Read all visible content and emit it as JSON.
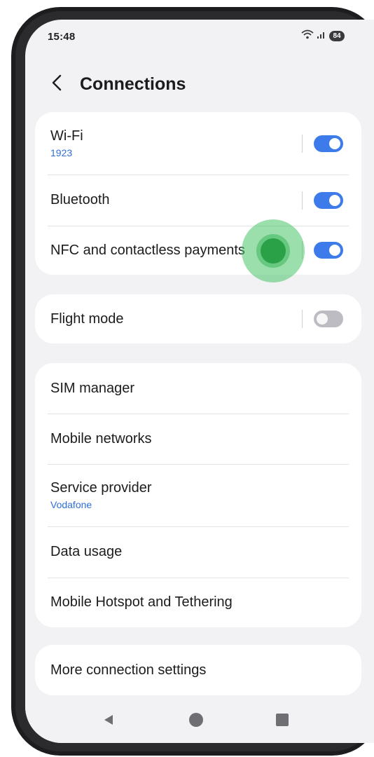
{
  "status_bar": {
    "time": "15:48",
    "battery": "84",
    "icons": [
      "wifi-icon",
      "signal-icon",
      "battery-icon"
    ]
  },
  "header": {
    "back_icon": "chevron-left-icon",
    "title": "Connections"
  },
  "groups": {
    "wireless": [
      {
        "label": "Wi-Fi",
        "sub": "1923",
        "toggle": true
      },
      {
        "label": "Bluetooth",
        "toggle": true
      },
      {
        "label": "NFC and contactless payments",
        "toggle": true
      }
    ],
    "flight": [
      {
        "label": "Flight mode",
        "toggle": false
      }
    ],
    "network": [
      {
        "label": "SIM manager"
      },
      {
        "label": "Mobile networks"
      },
      {
        "label": "Service provider",
        "sub": "Vodafone"
      },
      {
        "label": "Data usage"
      },
      {
        "label": "Mobile Hotspot and Tethering"
      }
    ],
    "more": [
      {
        "label": "More connection settings"
      }
    ]
  },
  "nav_bar": {
    "icons": [
      "back-triangle-icon",
      "home-circle-icon",
      "recents-square-icon"
    ]
  },
  "colors": {
    "accent": "#3e7bea",
    "subtext": "#2f6fd8",
    "touch": "#2aa047"
  }
}
